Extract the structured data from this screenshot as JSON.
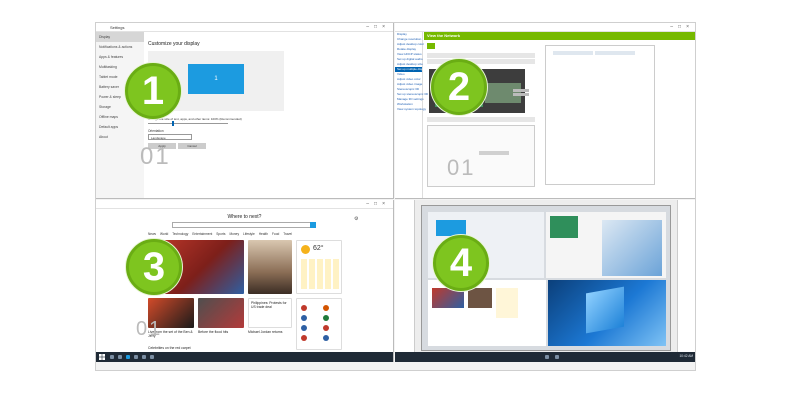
{
  "badges": {
    "b1": "1",
    "b2": "2",
    "b3": "3",
    "b4": "4"
  },
  "colors": {
    "badge": "#7ec51f",
    "accent_blue": "#1c9be0",
    "nvidia_green": "#76b900",
    "taskbar": "#1f2a36"
  },
  "settings": {
    "window_title": "Settings",
    "heading": "Customize your display",
    "monitor_number": "1",
    "nav_items": [
      "Display",
      "Notifications & actions",
      "Apps & features",
      "Multitasking",
      "Tablet mode",
      "Battery saver",
      "Power & sleep",
      "Storage",
      "Offline maps",
      "Default apps",
      "About"
    ],
    "text_size_label": "Change the size of text, apps, and other items: 100% (Recommended)",
    "orientation_label": "Orientation",
    "orientation_value": "Landscape",
    "apply_button": "Apply",
    "cancel_button": "Cancel",
    "doodle": "01"
  },
  "nvidia": {
    "section_title": "View the Network",
    "doodle": "01",
    "tree_items": [
      "Display",
      "Change resolution",
      "Adjust desktop color",
      "Rotate display",
      "View HDCP status",
      "Set up digital audio",
      "Adjust desktop size",
      "Set up multiple displays",
      "Video",
      "Adjust video color",
      "Adjust video image",
      "Stereoscopic 3D",
      "Set up stereoscopic 3D",
      "Manage 3D settings",
      "Workstation",
      "View system topology"
    ]
  },
  "edge": {
    "heading": "Where to next?",
    "nav_tabs": [
      "News",
      "World",
      "Technology",
      "Entertainment",
      "Sports",
      "Money",
      "Lifestyle",
      "Health",
      "Food",
      "Travel"
    ],
    "weather_temp": "62°",
    "doodle": "01",
    "story1": "Live from the set of the Ben & Jerry",
    "story2": "Before the flood hits",
    "story3": "Michael Jordan returns",
    "story4": "Philippines: Protests for US trade deal",
    "story5": "Celebrities on the red carpet"
  },
  "taskbar": {
    "clock": "10:42 AM"
  }
}
